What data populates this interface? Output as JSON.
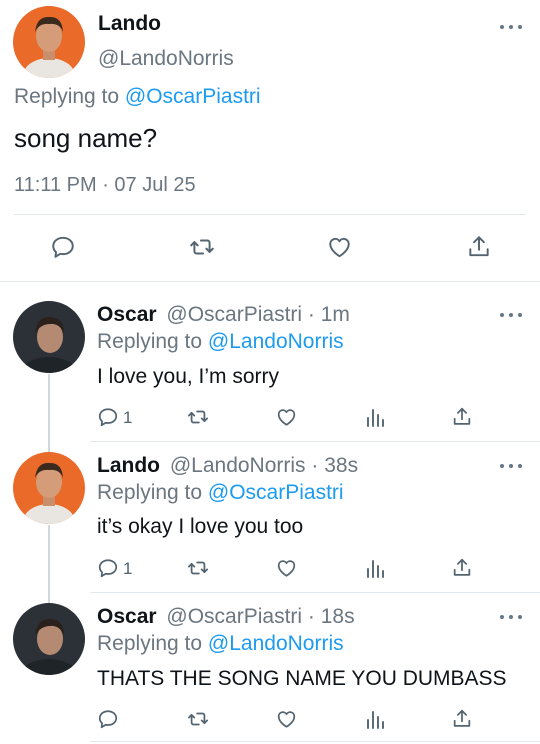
{
  "main_tweet": {
    "name": "Lando",
    "handle": "@LandoNorris",
    "replying_label": "Replying to",
    "replying_to": "@OscarPiastri",
    "text": "song name?",
    "timestamp": "11:11 PM · 07 Jul 25"
  },
  "replies": [
    {
      "name": "Oscar",
      "handle": "@OscarPiastri",
      "age": "· 1m",
      "replying_label": "Replying to",
      "replying_to": "@LandoNorris",
      "text": "I love you, I’m sorry",
      "reply_count": "1"
    },
    {
      "name": "Lando",
      "handle": "@LandoNorris",
      "age": "· 38s",
      "replying_label": "Replying to",
      "replying_to": "@OscarPiastri",
      "text": "it’s okay I love you too",
      "reply_count": "1"
    },
    {
      "name": "Oscar",
      "handle": "@OscarPiastri",
      "age": "· 18s",
      "replying_label": "Replying to",
      "replying_to": "@LandoNorris",
      "text": "THATS THE SONG NAME YOU DUMBASS",
      "reply_count": ""
    }
  ],
  "colors": {
    "link": "#1d9bf0",
    "secondary_text": "#6b7680",
    "icon": "#536471",
    "lando_avatar_bg": "#ea6a2a",
    "oscar_avatar_bg": "#2c3138"
  },
  "icons": [
    "more-icon",
    "reply-icon",
    "retweet-icon",
    "like-icon",
    "share-icon",
    "analytics-icon"
  ]
}
